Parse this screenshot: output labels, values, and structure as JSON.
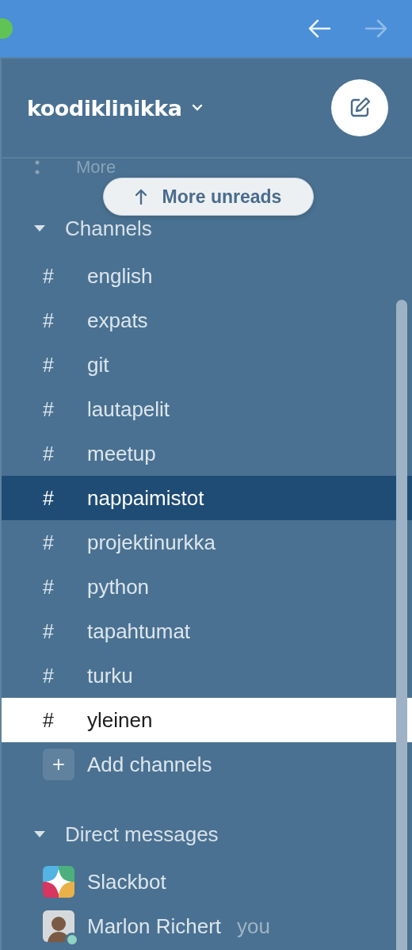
{
  "toolbar": {
    "back": {
      "disabled": false
    },
    "forward": {
      "disabled": true
    }
  },
  "workspace": {
    "name": "koodiklinikka"
  },
  "more_row": {
    "label": "More"
  },
  "unreads_pill": {
    "label": "More unreads"
  },
  "sections": [
    {
      "title": "Channels",
      "expanded": true,
      "kind": "channels",
      "items": [
        {
          "icon": "#",
          "name": "english",
          "selected": false,
          "highlighted": false
        },
        {
          "icon": "#",
          "name": "expats",
          "selected": false,
          "highlighted": false
        },
        {
          "icon": "#",
          "name": "git",
          "selected": false,
          "highlighted": false
        },
        {
          "icon": "#",
          "name": "lautapelit",
          "selected": false,
          "highlighted": false
        },
        {
          "icon": "#",
          "name": "meetup",
          "selected": false,
          "highlighted": false
        },
        {
          "icon": "#",
          "name": "nappaimistot",
          "selected": false,
          "highlighted": true
        },
        {
          "icon": "#",
          "name": "projektinurkka",
          "selected": false,
          "highlighted": false
        },
        {
          "icon": "#",
          "name": "python",
          "selected": false,
          "highlighted": false
        },
        {
          "icon": "#",
          "name": "tapahtumat",
          "selected": false,
          "highlighted": false
        },
        {
          "icon": "#",
          "name": "turku",
          "selected": false,
          "highlighted": false
        },
        {
          "icon": "#",
          "name": "yleinen",
          "selected": true,
          "highlighted": false
        }
      ],
      "add": {
        "icon": "+",
        "label": "Add channels"
      }
    },
    {
      "title": "Direct messages",
      "expanded": true,
      "kind": "dms",
      "items": [
        {
          "name": "Slackbot",
          "kind": "bot"
        },
        {
          "name": "Marlon Richert",
          "kind": "person",
          "suffix": "you",
          "online": true
        }
      ]
    }
  ]
}
